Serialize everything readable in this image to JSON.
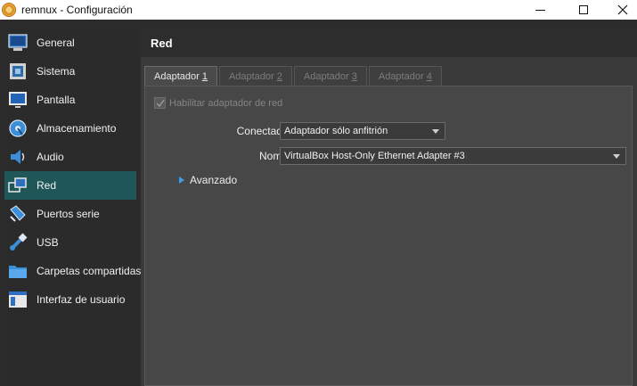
{
  "window": {
    "title": "remnux - Configuración"
  },
  "sidebar": {
    "items": [
      {
        "label": "General",
        "icon": "general-icon"
      },
      {
        "label": "Sistema",
        "icon": "system-icon"
      },
      {
        "label": "Pantalla",
        "icon": "display-icon"
      },
      {
        "label": "Almacenamiento",
        "icon": "storage-icon"
      },
      {
        "label": "Audio",
        "icon": "audio-icon"
      },
      {
        "label": "Red",
        "icon": "network-icon",
        "selected": true
      },
      {
        "label": "Puertos serie",
        "icon": "serial-port-icon"
      },
      {
        "label": "USB",
        "icon": "usb-icon"
      },
      {
        "label": "Carpetas compartidas",
        "icon": "shared-folder-icon"
      },
      {
        "label": "Interfaz de usuario",
        "icon": "user-interface-icon"
      }
    ]
  },
  "main": {
    "section_title": "Red",
    "tabs": [
      {
        "label": "Adaptador",
        "number": "1",
        "active": true
      },
      {
        "label": "Adaptador",
        "number": "2",
        "active": false
      },
      {
        "label": "Adaptador",
        "number": "3",
        "active": false
      },
      {
        "label": "Adaptador",
        "number": "4",
        "active": false
      }
    ],
    "enable_adapter": {
      "label": "Habilitar adaptador de red",
      "checked": true,
      "disabled": true
    },
    "attached_to": {
      "label": "Conectado a:",
      "value": "Adaptador sólo anfitrión"
    },
    "name": {
      "label": "Nombre:",
      "value": "VirtualBox Host-Only Ethernet Adapter #3"
    },
    "advanced": {
      "label": "Avanzado"
    }
  },
  "colors": {
    "selected_item": "#1f5658",
    "accent_triangle": "#3c9ee8"
  }
}
